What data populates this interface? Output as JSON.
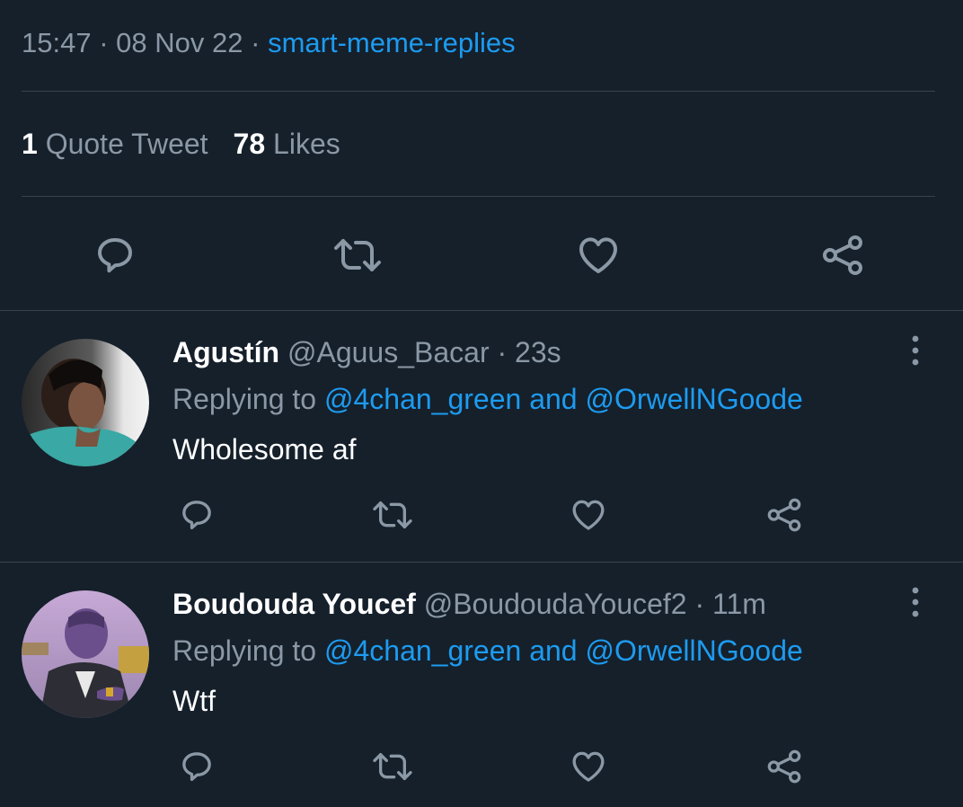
{
  "tweet": {
    "time": "15:47",
    "date": "08 Nov 22",
    "source": "smart-meme-replies",
    "separator": "·",
    "quote_count": "1",
    "quote_label": "Quote Tweet",
    "like_count": "78",
    "like_label": "Likes",
    "actions": [
      "reply-icon",
      "retweet-icon",
      "like-icon",
      "share-icon"
    ]
  },
  "replies": [
    {
      "name": "Agustín",
      "handle": "@Aguus_Bacar",
      "time": "23s",
      "replying_prefix": "Replying to",
      "mention_1": "@4chan_green",
      "conjunction": "and",
      "mention_2": "@OrwellNGoode",
      "text": "Wholesome af"
    },
    {
      "name": "Boudouda Youcef",
      "handle": "@BoudoudaYoucef2",
      "time": "11m",
      "replying_prefix": "Replying to",
      "mention_1": "@4chan_green",
      "conjunction": "and",
      "mention_2": "@OrwellNGoode",
      "text": "Wtf"
    }
  ],
  "colors": {
    "background": "#15202b",
    "accent": "#1d9bf0",
    "secondary_text": "#8b98a5",
    "divider": "#38444d"
  }
}
